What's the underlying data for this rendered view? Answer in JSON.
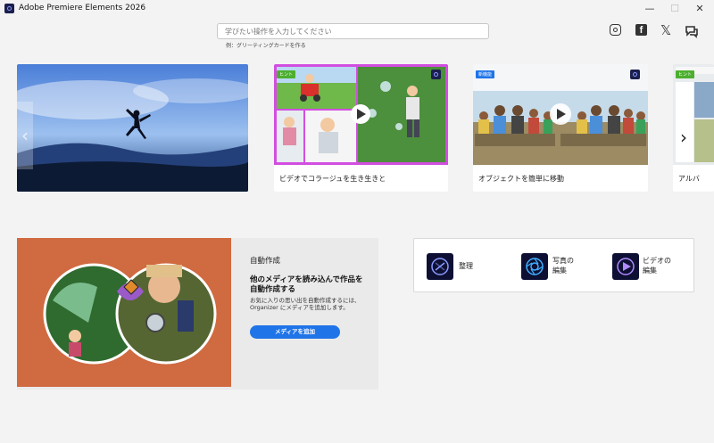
{
  "window": {
    "title": "Adobe Premiere Elements 2026",
    "minimize": "—",
    "maximize": "☐",
    "close": "✕"
  },
  "search": {
    "placeholder": "学びたい操作を入力してください",
    "hint": "例：グリーティングカードを作る"
  },
  "social": [
    "instagram-icon",
    "facebook-icon",
    "x-icon",
    "discord-icon"
  ],
  "carousel": {
    "prev_arrow": "‹",
    "next_arrow": "›",
    "cards": [
      {
        "label": "",
        "badge": ""
      },
      {
        "label": "ビデオでコラージュを生き生きと",
        "badge": "ヒント"
      },
      {
        "label": "オブジェクトを簡単に移動",
        "badge": "新機能"
      },
      {
        "label": "アルバ",
        "badge": "ヒント"
      }
    ]
  },
  "auto_create": {
    "heading": "自動作成",
    "title": "他のメディアを読み込んで作品を自動作成する",
    "description": "お気に入りの思い出を自動作成するには、Organizer にメディアを追加します。",
    "button": "メディアを追加"
  },
  "quick_actions": [
    {
      "label": "整理",
      "icon": "organize-icon"
    },
    {
      "label": "写真の\n編集",
      "icon": "photo-edit-icon"
    },
    {
      "label": "ビデオの\n編集",
      "icon": "video-edit-icon"
    }
  ],
  "colors": {
    "accent": "#1f74e8",
    "tip_badge": "#4caf2f",
    "app_icon": "#1b1f4d",
    "auto_bg": "#d06a40"
  }
}
